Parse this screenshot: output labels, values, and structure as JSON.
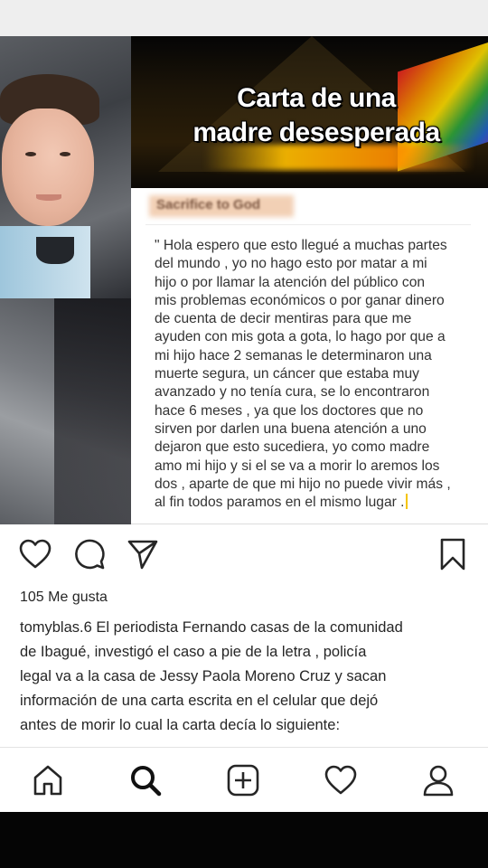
{
  "post_image": {
    "banner_title_line1": "Carta de una",
    "banner_title_line2": "madre desesperada",
    "blurred_label": "Sacrifice to God",
    "letter_lines": [
      "\" Hola espero que esto llegué a muchas partes",
      "del mundo , yo no hago esto por matar a mi",
      "hijo o por llamar la atención del público con",
      "mis problemas económicos o por ganar dinero",
      "de cuenta de decir mentiras para que me",
      "ayuden con mis gota a gota, lo hago por que a",
      "mi hijo hace 2 semanas le determinaron una",
      "muerte segura, un cáncer que estaba muy",
      "avanzado y no tenía cura, se lo encontraron",
      "hace 6 meses , ya que los doctores que no",
      "sirven por darlen una buena atención a uno",
      "dejaron que esto sucediera, yo como madre",
      "amo mi hijo y si el se va a morir lo aremos los",
      "dos , aparte de que mi hijo no puede vivir más ,",
      "al fin todos paramos en el mismo lugar ."
    ]
  },
  "actions": {
    "like_icon": "heart-icon",
    "comment_icon": "comment-icon",
    "share_icon": "send-icon",
    "save_icon": "bookmark-icon"
  },
  "likes_text": "105 Me gusta",
  "caption": {
    "username": "tomyblas.6",
    "lines": [
      " El periodista Fernando casas de la comunidad",
      "de Ibagué, investigó el caso a pie de la letra , policía",
      "legal va a la casa de Jessy Paola Moreno Cruz y sacan",
      "información de una carta escrita en el celular que dejó",
      "antes de morir lo cual la carta decía lo siguiente:"
    ]
  },
  "bottom_nav": [
    "home-icon",
    "search-icon",
    "new-post-icon",
    "activity-heart-icon",
    "profile-icon"
  ],
  "colors": {
    "text": "#262626",
    "letter_text": "#333333",
    "banner_gold": "#ffbe00",
    "highlight_caret": "#f5c400"
  }
}
